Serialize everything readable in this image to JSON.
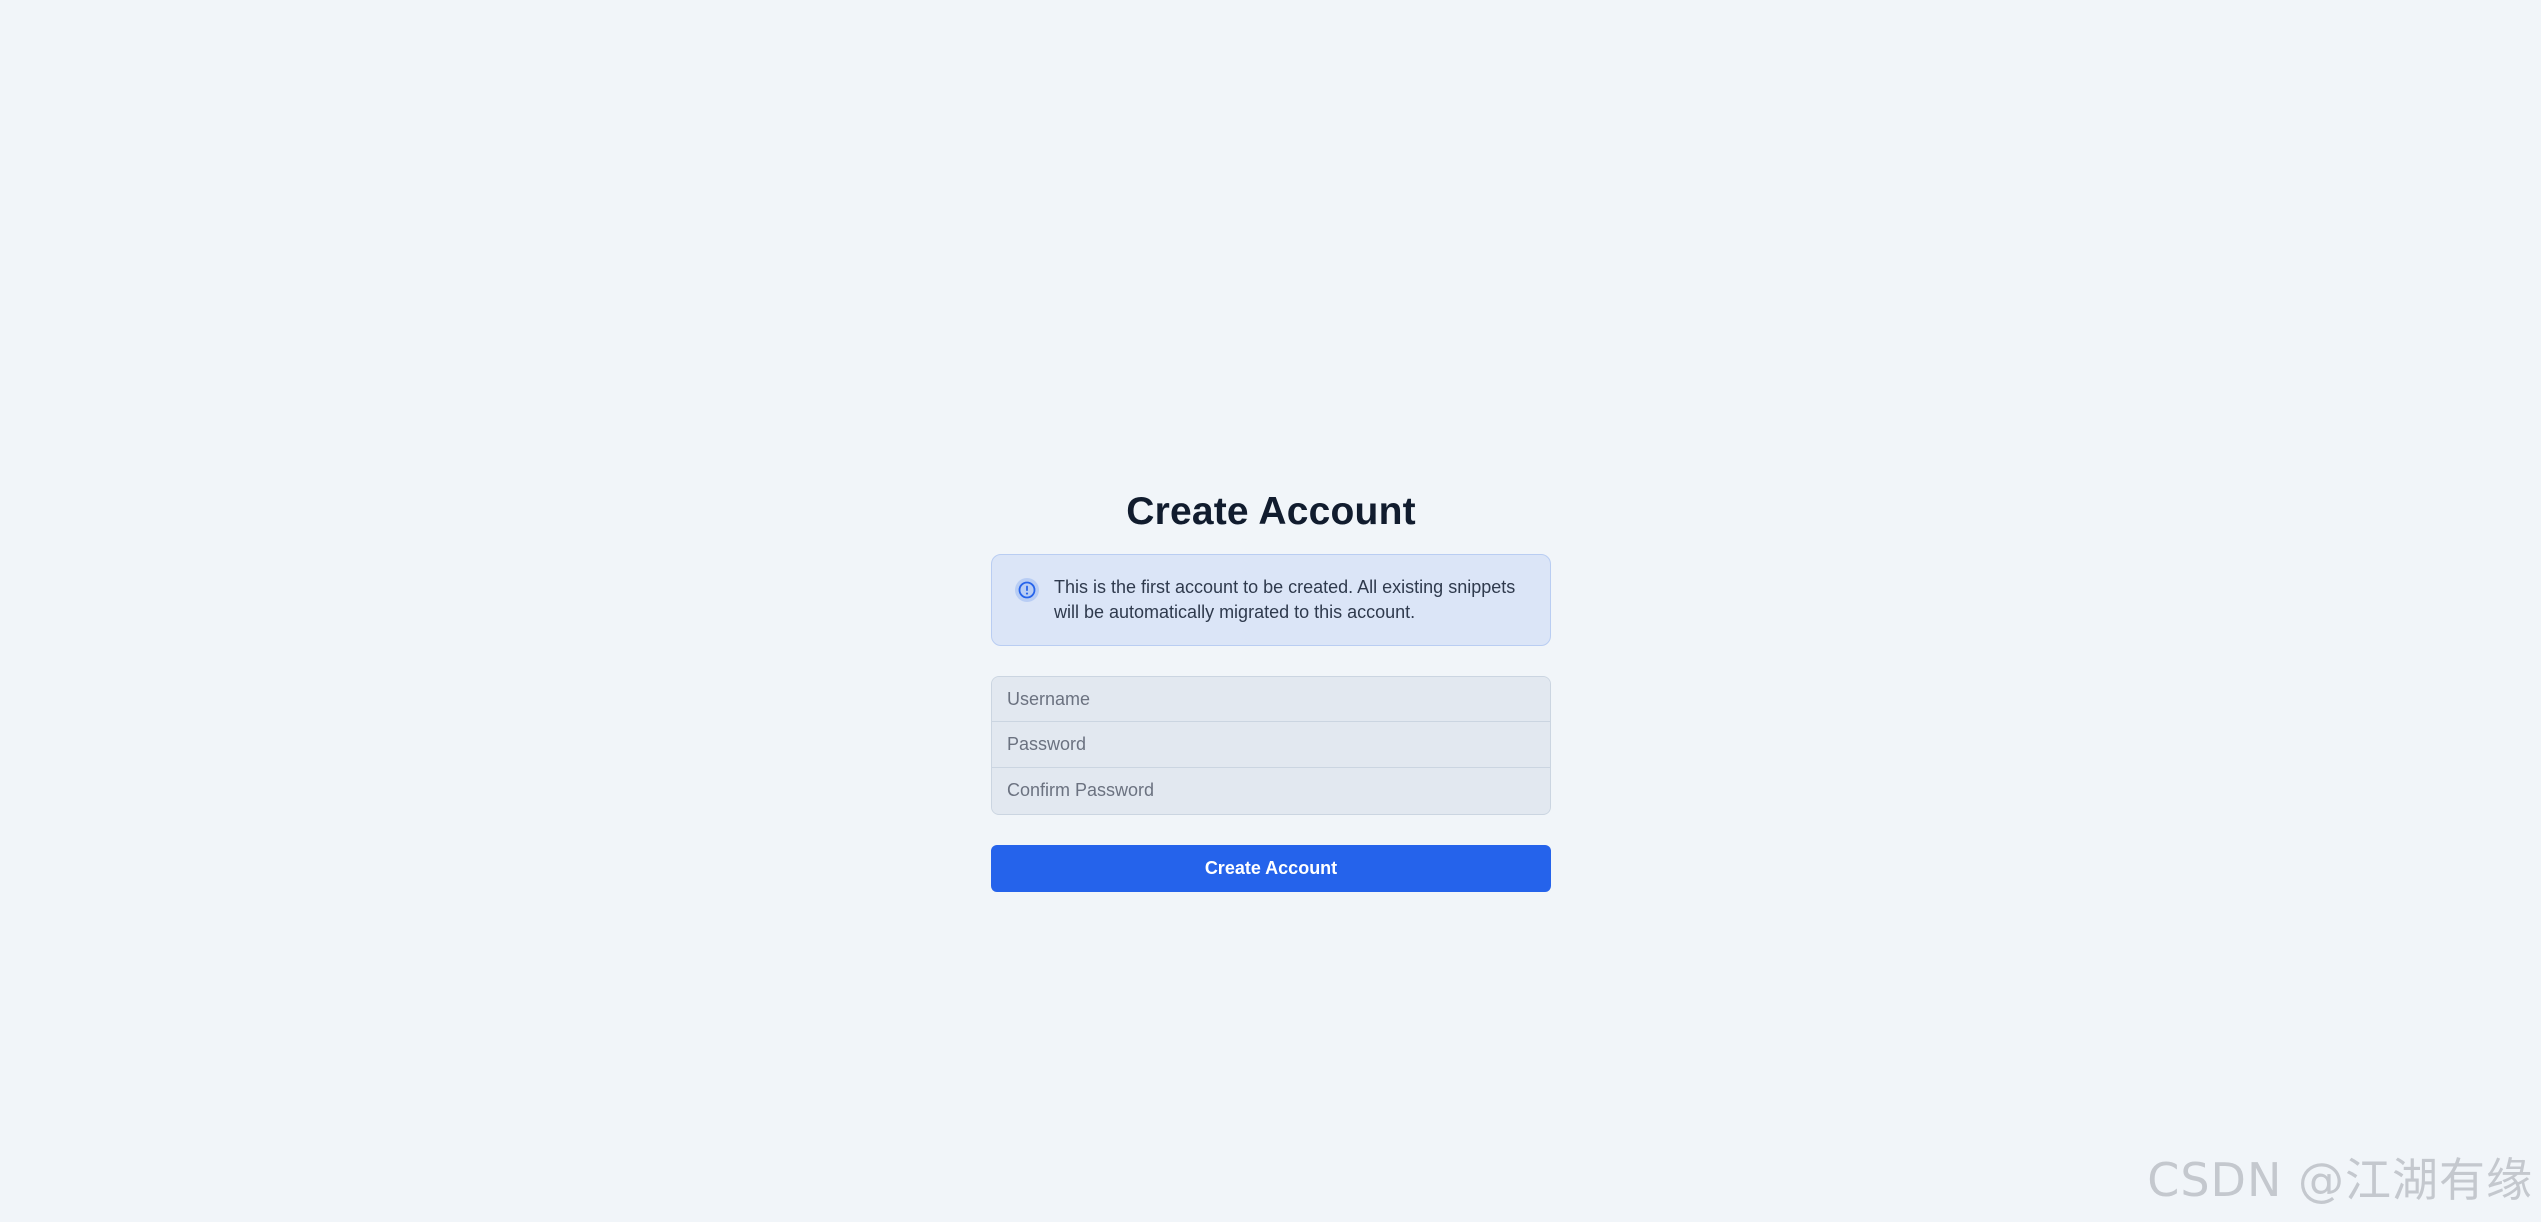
{
  "page": {
    "title": "Create Account"
  },
  "notice": {
    "icon": "info-circle-icon",
    "text": "This is the first account to be created. All existing snippets will be automatically migrated to this account.",
    "background_color": "#dbe5f7",
    "border_color": "#b9cdf2",
    "icon_color": "#2563eb"
  },
  "form": {
    "username": {
      "value": "",
      "placeholder": "Username"
    },
    "password": {
      "value": "",
      "placeholder": "Password"
    },
    "confirm_password": {
      "value": "",
      "placeholder": "Confirm Password"
    },
    "submit_label": "Create Account"
  },
  "colors": {
    "background": "#f1f5f9",
    "accent": "#2563eb",
    "title": "#111c2e"
  },
  "watermark": {
    "text": "CSDN @江湖有缘"
  }
}
